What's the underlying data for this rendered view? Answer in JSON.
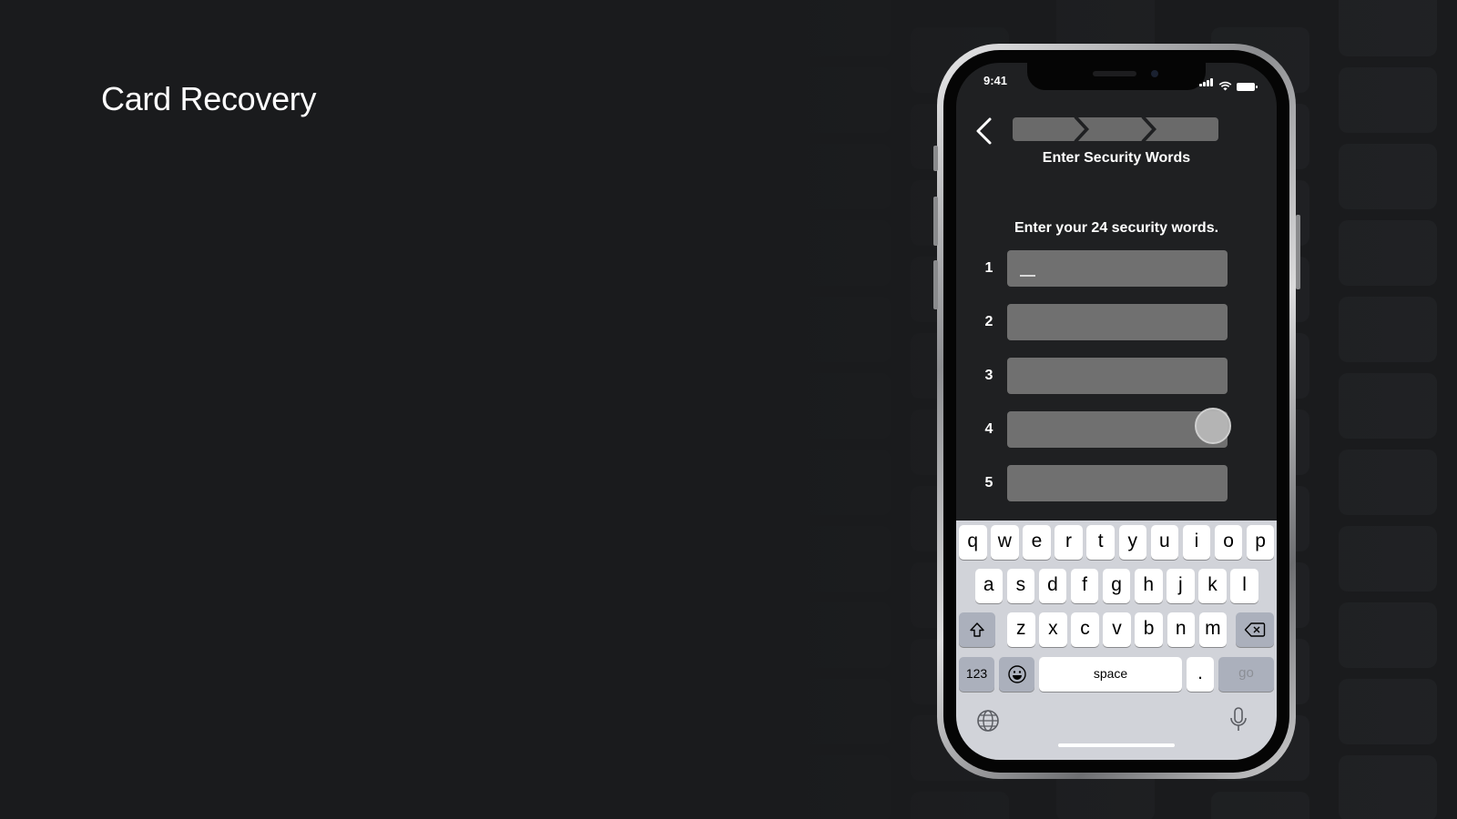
{
  "presentation": {
    "title": "Card Recovery"
  },
  "status_bar": {
    "time": "9:41"
  },
  "nav": {
    "title": "Enter Security Words",
    "steps_total": 3
  },
  "main": {
    "instruction": "Enter your 24 security words.",
    "word_fields": [
      {
        "number": "1",
        "value": ""
      },
      {
        "number": "2",
        "value": ""
      },
      {
        "number": "3",
        "value": ""
      },
      {
        "number": "4",
        "value": ""
      },
      {
        "number": "5",
        "value": ""
      }
    ]
  },
  "keyboard": {
    "row1": [
      "q",
      "w",
      "e",
      "r",
      "t",
      "y",
      "u",
      "i",
      "o",
      "p"
    ],
    "row2": [
      "a",
      "s",
      "d",
      "f",
      "g",
      "h",
      "j",
      "k",
      "l"
    ],
    "row3": [
      "z",
      "x",
      "c",
      "v",
      "b",
      "n",
      "m"
    ],
    "numbers_label": "123",
    "space_label": "space",
    "period_label": ".",
    "go_label": "go"
  },
  "colors": {
    "background": "#1a1b1d",
    "screen": "#1f2022",
    "input_fill": "#707070",
    "stepper_fill": "#6a6a6a",
    "keyboard_bg": "#d1d3d9"
  },
  "icons": [
    "chevron-left-icon",
    "shift-icon",
    "backspace-icon",
    "emoji-icon",
    "globe-icon",
    "microphone-icon",
    "signal-icon",
    "wifi-icon",
    "battery-icon"
  ]
}
